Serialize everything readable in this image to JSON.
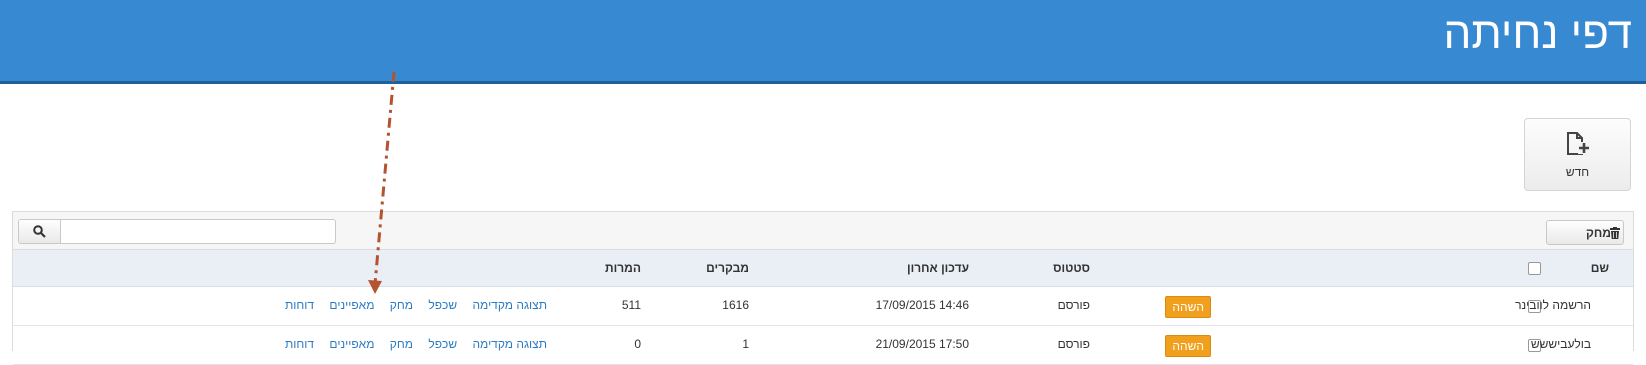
{
  "header": {
    "title": "דפי נחיתה"
  },
  "actions": {
    "new_label": "חדש"
  },
  "toolbar": {
    "delete_label": "מחק",
    "search_placeholder": "",
    "search_value": ""
  },
  "table": {
    "columns": {
      "name": "שם",
      "status": "סטטוס",
      "updated": "עדכון אחרון",
      "visitors": "מבקרים",
      "conversions": "המרות"
    },
    "rows": [
      {
        "name": "הרשמה לוובינר",
        "badge": "השהה",
        "status": "פורסם",
        "updated": "17/09/2015 14:46",
        "visitors": "1616",
        "conversions": "511",
        "links": {
          "preview": "תצוגה מקדימה",
          "duplicate": "שכפל",
          "delete": "מחק",
          "properties": "מאפיינים",
          "reports": "דוחות"
        }
      },
      {
        "name": "בולעביששש",
        "badge": "השהה",
        "status": "פורסם",
        "updated": "21/09/2015 17:50",
        "visitors": "1",
        "conversions": "0",
        "links": {
          "preview": "תצוגה מקדימה",
          "duplicate": "שכפל",
          "delete": "מחק",
          "properties": "מאפיינים",
          "reports": "דוחות"
        }
      }
    ]
  },
  "colors": {
    "header_bg": "#3789d2",
    "badge": "#f0a01c",
    "link": "#2c7cc4",
    "annotation_arrow": "#b5522f"
  },
  "icons": {
    "new": "new-document-icon",
    "delete": "trash-icon",
    "search": "search-icon"
  }
}
